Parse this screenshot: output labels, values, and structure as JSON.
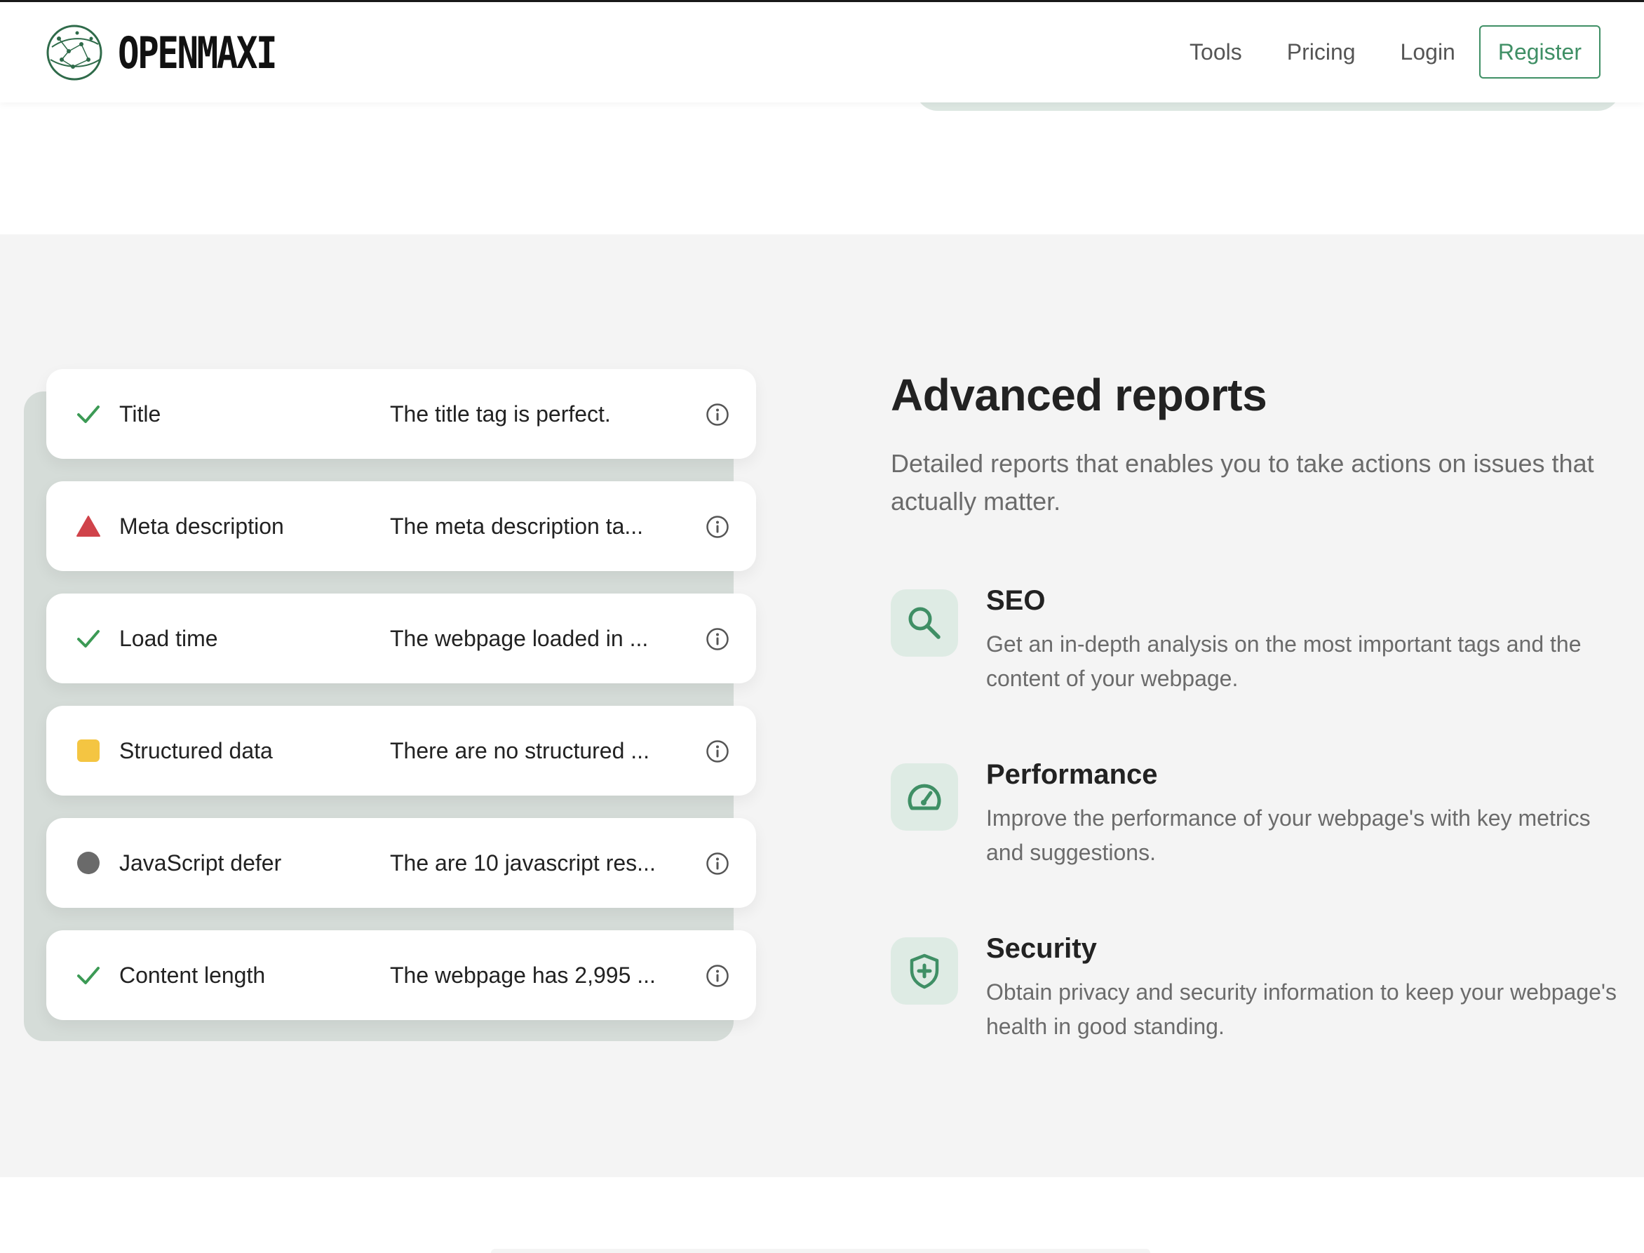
{
  "brand": {
    "name": "OPENMAXI",
    "logo_icon": "constellation-globe-icon"
  },
  "nav": {
    "links": [
      "Tools",
      "Pricing",
      "Login"
    ],
    "register_label": "Register"
  },
  "checks": [
    {
      "status": "pass",
      "icon": "check-icon",
      "name": "Title",
      "description": "The title tag is perfect."
    },
    {
      "status": "fail",
      "icon": "warning-triangle-icon",
      "name": "Meta description",
      "description": "The meta description ta..."
    },
    {
      "status": "pass",
      "icon": "check-icon",
      "name": "Load time",
      "description": "The webpage loaded in ..."
    },
    {
      "status": "warning",
      "icon": "warning-square-icon",
      "name": "Structured data",
      "description": "There are no structured ..."
    },
    {
      "status": "info",
      "icon": "info-circle-dot-icon",
      "name": "JavaScript defer",
      "description": "The are 10 javascript res..."
    },
    {
      "status": "pass",
      "icon": "check-icon",
      "name": "Content length",
      "description": "The webpage has 2,995 ..."
    }
  ],
  "section": {
    "heading": "Advanced reports",
    "lead": "Detailed reports that enables you to take actions on issues that actually matter."
  },
  "features": [
    {
      "icon": "search-icon",
      "title": "SEO",
      "text": "Get an in-depth analysis on the most important tags and the content of your webpage."
    },
    {
      "icon": "speedometer-icon",
      "title": "Performance",
      "text": "Improve the performance of your webpage's with key metrics and suggestions."
    },
    {
      "icon": "shield-plus-icon",
      "title": "Security",
      "text": "Obtain privacy and security information to keep your webpage's health in good standing."
    }
  ],
  "colors": {
    "accent": "#3f8f65",
    "pass": "#3c9a55",
    "fail": "#d0434a",
    "warning": "#f4c542",
    "info": "#6a6a6a",
    "section_bg": "#f4f4f4"
  }
}
